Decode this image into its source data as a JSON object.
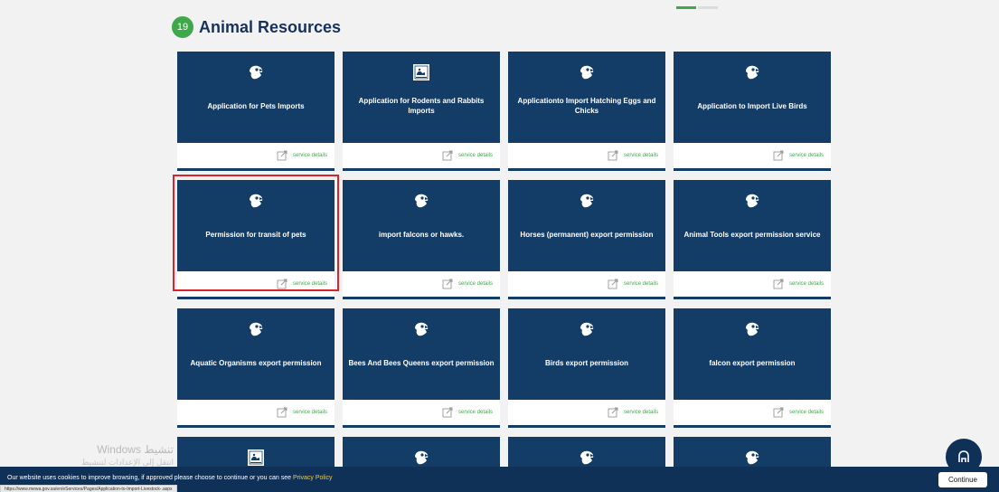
{
  "section": {
    "count": "19",
    "title": "Animal Resources"
  },
  "cards": [
    {
      "title": "Application for Pets Imports",
      "icon": "falcon-icon",
      "link": "service details"
    },
    {
      "title": "Application for Rodents and Rabbits Imports",
      "icon": "rodents-icon",
      "link": "service details"
    },
    {
      "title": "Applicationto Import Hatching Eggs and Chicks",
      "icon": "falcon-icon",
      "link": "service details"
    },
    {
      "title": "Application to Import Live Birds",
      "icon": "falcon-icon",
      "link": "service details"
    },
    {
      "title": "Permission for transit of pets",
      "icon": "falcon-icon",
      "link": "service details"
    },
    {
      "title": "import falcons or hawks.",
      "icon": "falcon-icon",
      "link": "service details"
    },
    {
      "title": "Horses (permanent) export permission",
      "icon": "falcon-icon",
      "link": "service details"
    },
    {
      "title": "Animal Tools export permission service",
      "icon": "falcon-icon",
      "link": "service details"
    },
    {
      "title": "Aquatic Organisms export permission",
      "icon": "falcon-icon",
      "link": "service details"
    },
    {
      "title": "Bees And Bees Queens export permission",
      "icon": "falcon-icon",
      "link": "service details"
    },
    {
      "title": "Birds export permission",
      "icon": "falcon-icon",
      "link": "service details"
    },
    {
      "title": "falcon export permission",
      "icon": "falcon-icon",
      "link": "service details"
    }
  ],
  "partial_cards": [
    {
      "icon": "rodents-icon"
    },
    {
      "icon": "falcon-icon"
    },
    {
      "icon": "falcon-icon"
    },
    {
      "icon": "falcon-icon"
    }
  ],
  "watermark": {
    "line1": "Windows تنشيط",
    "line2": "انتقل إلى الإعدادات لتنشيط Windows."
  },
  "cookie": {
    "text": "Our website uses cookies to improve browsing, if approved please choose to continue or you can see",
    "link": "Privacy Policy",
    "button": "Continue"
  },
  "status_url": "https://www.mewa.gov.sa/en/eServices/Pages/Application-to-Import-Livestock-.aspx",
  "colors": {
    "card_bg": "#133d67",
    "accent_green": "#3fa84a",
    "highlight_red": "#d9232d",
    "cookie_bar": "#0f3158"
  }
}
